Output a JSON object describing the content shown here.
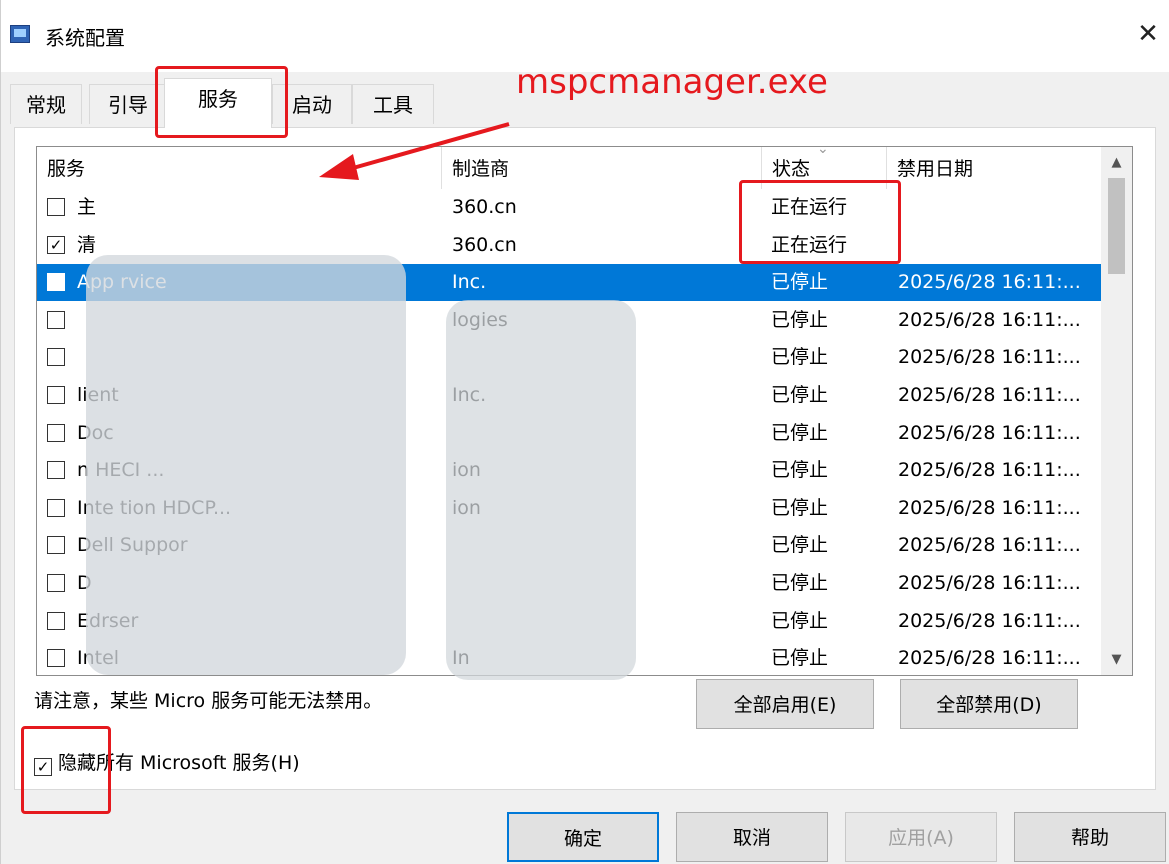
{
  "window": {
    "title": "系统配置",
    "close_glyph": "✕"
  },
  "tabs": [
    {
      "label": "常规",
      "active": false
    },
    {
      "label": "引导",
      "active": false
    },
    {
      "label": "服务",
      "active": true
    },
    {
      "label": "启动",
      "active": false
    },
    {
      "label": "工具",
      "active": false
    }
  ],
  "annotation": {
    "text": "mspcmanager.exe",
    "color": "#e5191e"
  },
  "services_table": {
    "headers": {
      "service": "服务",
      "manufacturer": "制造商",
      "status": "状态",
      "disabled_date": "禁用日期"
    },
    "rows": [
      {
        "checked": false,
        "service": "主",
        "manufacturer": "360.cn",
        "status": "正在运行",
        "date": "",
        "selected": false
      },
      {
        "checked": true,
        "service": "清",
        "manufacturer": "360.cn",
        "status": "正在运行",
        "date": "",
        "selected": false
      },
      {
        "checked": false,
        "service": "App                              rvice",
        "manufacturer": "          Inc.",
        "status": "已停止",
        "date": "2025/6/28 16:11:...",
        "selected": true
      },
      {
        "checked": false,
        "service": "",
        "manufacturer": "            logies",
        "status": "已停止",
        "date": "2025/6/28 16:11:...",
        "selected": false
      },
      {
        "checked": false,
        "service": "",
        "manufacturer": "",
        "status": "已停止",
        "date": "2025/6/28 16:11:...",
        "selected": false
      },
      {
        "checked": false,
        "service": "                      lient",
        "manufacturer": "          Inc.",
        "status": "已停止",
        "date": "2025/6/28 16:11:...",
        "selected": false
      },
      {
        "checked": false,
        "service": "Doc",
        "manufacturer": "",
        "status": "已停止",
        "date": "2025/6/28 16:11:...",
        "selected": false
      },
      {
        "checked": false,
        "service": "                        n HECI ...",
        "manufacturer": "                ion",
        "status": "已停止",
        "date": "2025/6/28 16:11:...",
        "selected": false
      },
      {
        "checked": false,
        "service": "Inte                     tion HDCP...",
        "manufacturer": "                ion",
        "status": "已停止",
        "date": "2025/6/28 16:11:...",
        "selected": false
      },
      {
        "checked": false,
        "service": "Dell Suppor",
        "manufacturer": "",
        "status": "已停止",
        "date": "2025/6/28 16:11:...",
        "selected": false
      },
      {
        "checked": false,
        "service": "D",
        "manufacturer": "",
        "status": "已停止",
        "date": "2025/6/28 16:11:...",
        "selected": false
      },
      {
        "checked": false,
        "service": "Edrser",
        "manufacturer": "",
        "status": "已停止",
        "date": "2025/6/28 16:11:...",
        "selected": false
      },
      {
        "checked": false,
        "service": "Intel",
        "manufacturer": "In",
        "status": "已停止",
        "date": "2025/6/28 16:11:...",
        "selected": false
      }
    ]
  },
  "note": "请注意，某些 Micro            服务可能无法禁用。",
  "buttons": {
    "enable_all": "全部启用(E)",
    "disable_all": "全部禁用(D)",
    "ok": "确定",
    "cancel": "取消",
    "apply": "应用(A)",
    "help": "帮助"
  },
  "hide_ms": {
    "label": "隐藏所有 Microsoft 服务(H)",
    "checked": true
  },
  "check_glyph": "✓"
}
